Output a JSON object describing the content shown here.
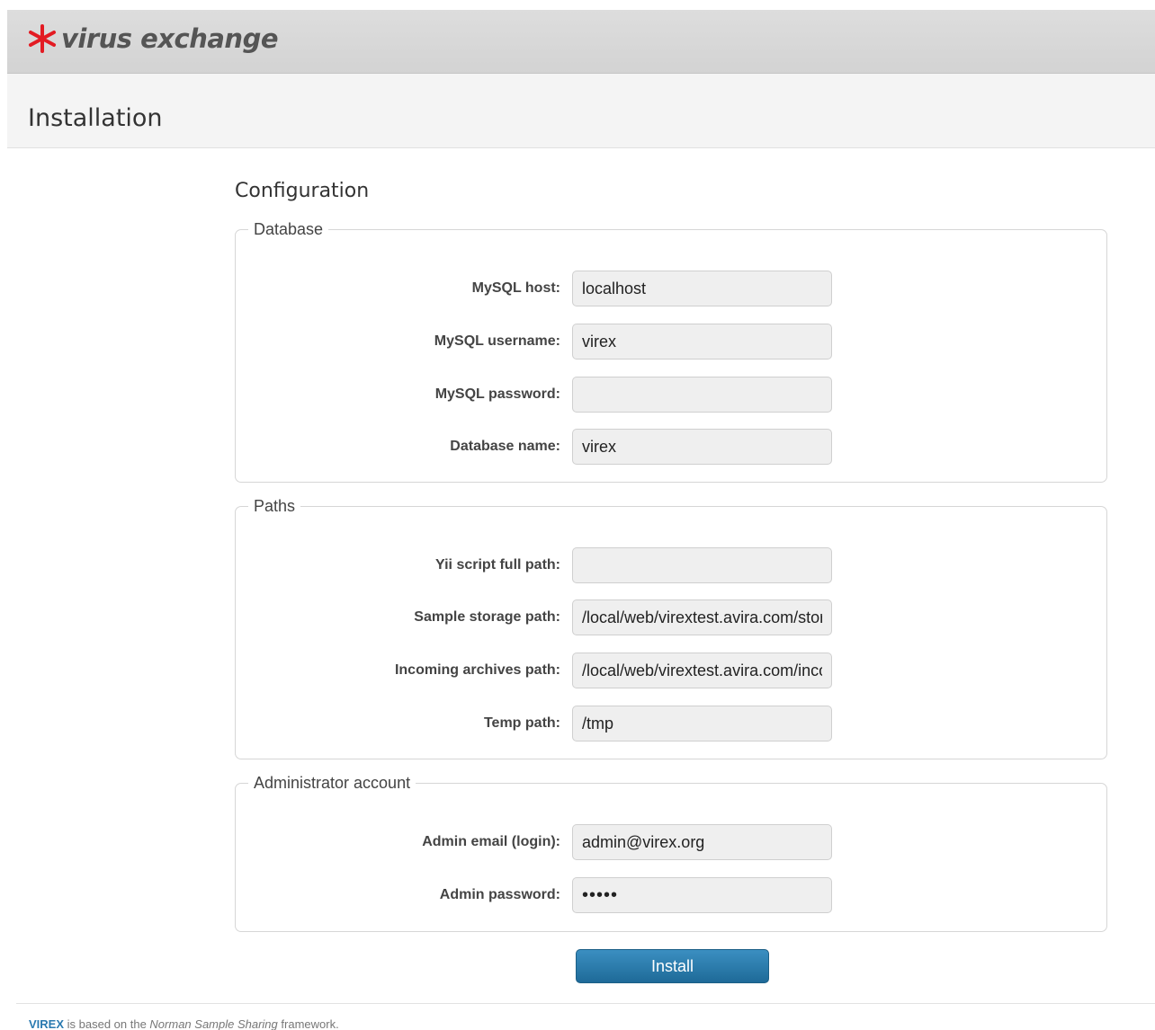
{
  "header": {
    "logo_text": "virus exchange",
    "logo_color": "#e31b23"
  },
  "page": {
    "title": "Installation"
  },
  "form": {
    "title": "Configuration",
    "database": {
      "legend": "Database",
      "host_label": "MySQL host:",
      "host_value": "localhost",
      "username_label": "MySQL username:",
      "username_value": "virex",
      "password_label": "MySQL password:",
      "password_value": "",
      "dbname_label": "Database name:",
      "dbname_value": "virex"
    },
    "paths": {
      "legend": "Paths",
      "yii_label": "Yii script full path:",
      "yii_value": "",
      "storage_label": "Sample storage path:",
      "storage_value": "/local/web/virextest.avira.com/storage",
      "incoming_label": "Incoming archives path:",
      "incoming_value": "/local/web/virextest.avira.com/incoming",
      "temp_label": "Temp path:",
      "temp_value": "/tmp"
    },
    "admin": {
      "legend": "Administrator account",
      "email_label": "Admin email (login):",
      "email_value": "admin@virex.org",
      "password_label": "Admin password:",
      "password_value": "admin"
    },
    "install_label": "Install"
  },
  "footer": {
    "brand": "VIREX",
    "text_before": " is based on the ",
    "framework": "Norman Sample Sharing",
    "text_after": " framework."
  }
}
